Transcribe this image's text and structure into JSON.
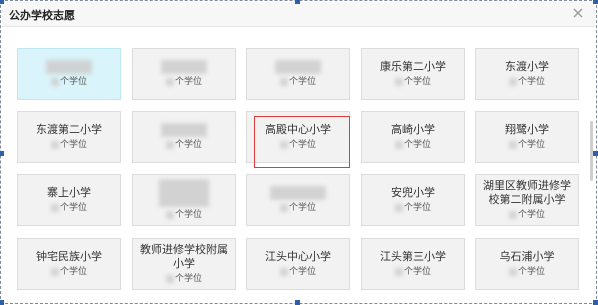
{
  "dialog": {
    "title": "公办学校志愿",
    "close_icon": "close-icon"
  },
  "tiles": [
    {
      "name": "",
      "seats": "个学位",
      "selected": true
    },
    {
      "name": "",
      "seats": "个学位"
    },
    {
      "name": "",
      "seats": "个学位"
    },
    {
      "name": "康乐第二小学",
      "seats": "个学位"
    },
    {
      "name": "东渡小学",
      "seats": "个学位"
    },
    {
      "name": "东渡第二小学",
      "seats": "个学位"
    },
    {
      "name": "",
      "seats": "个学位"
    },
    {
      "name": "高殿中心小学",
      "seats": "个学位"
    },
    {
      "name": "高崎小学",
      "seats": "个学位"
    },
    {
      "name": "翔鹭小学",
      "seats": "个学位"
    },
    {
      "name": "寨上小学",
      "seats": "个学位"
    },
    {
      "name": "",
      "seats": "个学位"
    },
    {
      "name": "",
      "seats": "个学位"
    },
    {
      "name": "安兜小学",
      "seats": "个学位"
    },
    {
      "name": "湖里区教师进修学校第二附属小学",
      "seats": "个学位"
    },
    {
      "name": "钟宅民族小学",
      "seats": "个学位"
    },
    {
      "name": "教师进修学校附属小学",
      "seats": "个学位"
    },
    {
      "name": "江头中心小学",
      "seats": "个学位"
    },
    {
      "name": "江头第三小学",
      "seats": "个学位"
    },
    {
      "name": "乌石浦小学",
      "seats": "个学位"
    }
  ],
  "colors": {
    "tile_bg": "#f2f2f2",
    "tile_selected_bg": "#d9f4fa",
    "highlight_border": "#e03a3a",
    "selection_handle": "#2f5fa8"
  }
}
